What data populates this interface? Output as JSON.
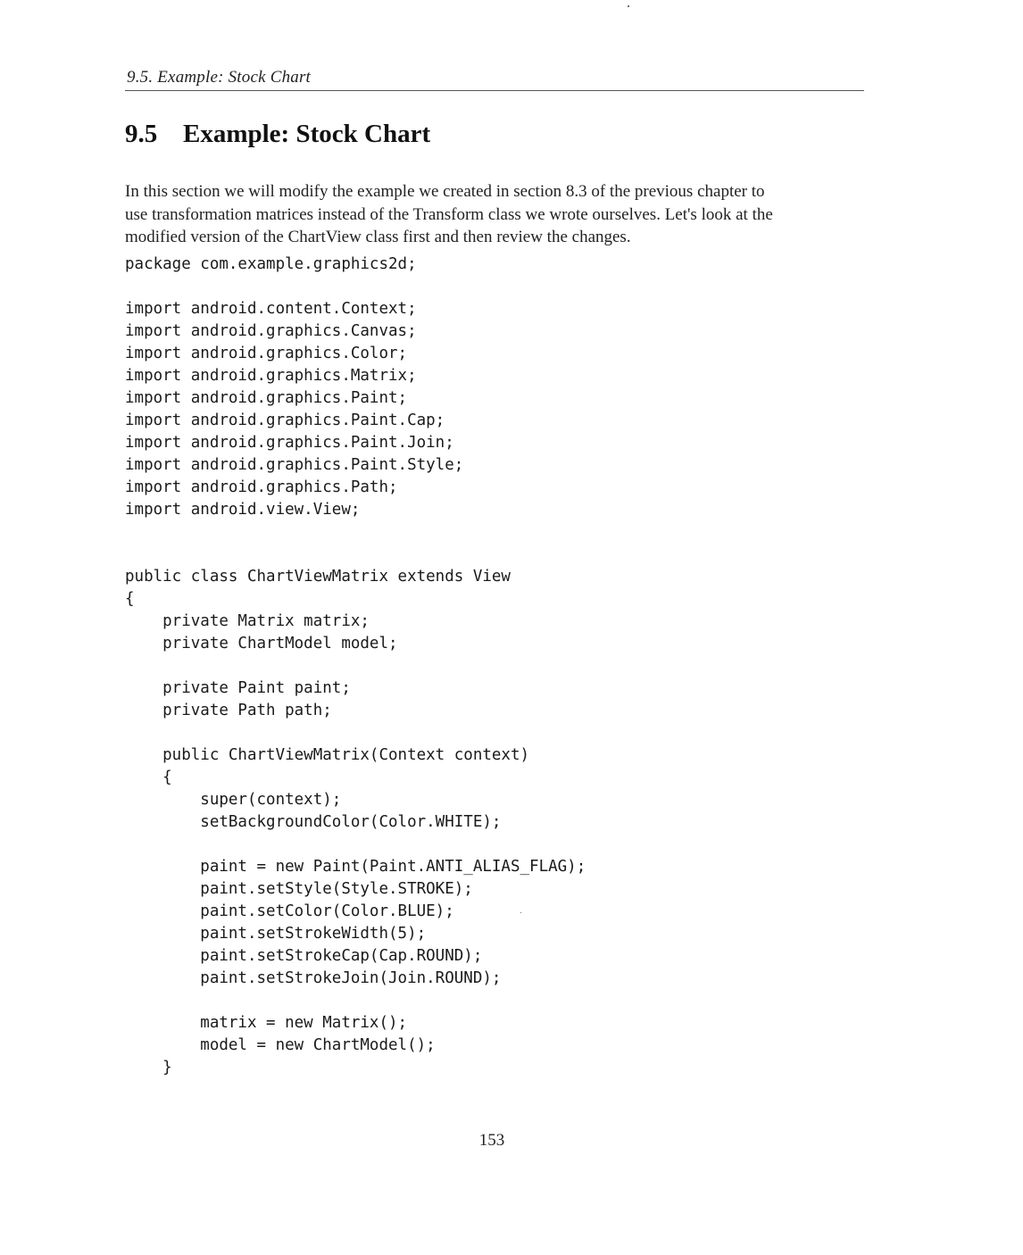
{
  "header": {
    "running_title": "9.5. Example: Stock Chart"
  },
  "section": {
    "number": "9.5",
    "title": "Example: Stock Chart"
  },
  "intro_lines": [
    "In this section we will modify the example we created in section 8.3 of the previous chapter to",
    "use transformation matrices instead of the Transform class we wrote ourselves. Let's look at the",
    "modified version of the ChartView class first and then review the changes."
  ],
  "code_lines": [
    "package com.example.graphics2d;",
    "",
    "import android.content.Context;",
    "import android.graphics.Canvas;",
    "import android.graphics.Color;",
    "import android.graphics.Matrix;",
    "import android.graphics.Paint;",
    "import android.graphics.Paint.Cap;",
    "import android.graphics.Paint.Join;",
    "import android.graphics.Paint.Style;",
    "import android.graphics.Path;",
    "import android.view.View;",
    "",
    "",
    "public class ChartViewMatrix extends View",
    "{",
    "    private Matrix matrix;",
    "    private ChartModel model;",
    "",
    "    private Paint paint;",
    "    private Path path;",
    "",
    "    public ChartViewMatrix(Context context)",
    "    {",
    "        super(context);",
    "        setBackgroundColor(Color.WHITE);",
    "",
    "        paint = new Paint(Paint.ANTI_ALIAS_FLAG);",
    "        paint.setStyle(Style.STROKE);",
    "        paint.setColor(Color.BLUE);",
    "        paint.setStrokeWidth(5);",
    "        paint.setStrokeCap(Cap.ROUND);",
    "        paint.setStrokeJoin(Join.ROUND);",
    "",
    "        matrix = new Matrix();",
    "        model = new ChartModel();",
    "    }"
  ],
  "footer": {
    "page_number": "153"
  }
}
